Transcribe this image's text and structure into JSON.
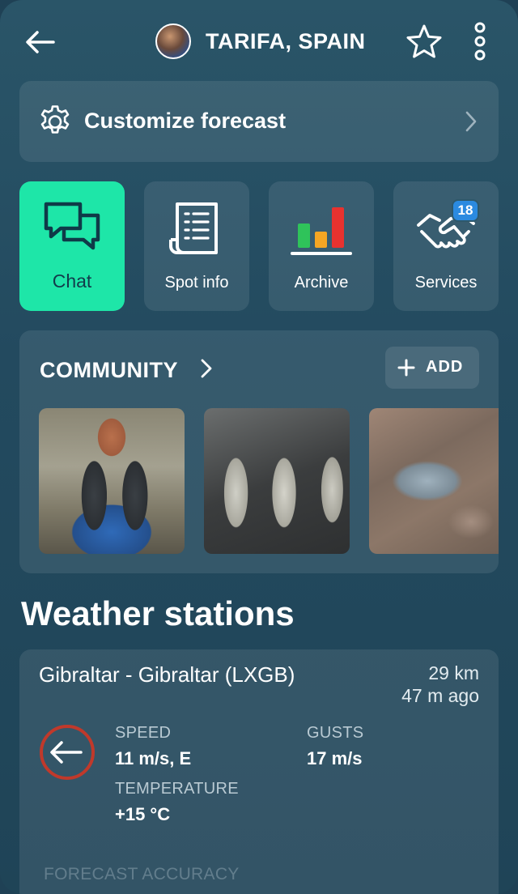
{
  "header": {
    "title": "TARIFA, SPAIN"
  },
  "customize": {
    "label": "Customize forecast"
  },
  "tiles": [
    {
      "label": "Chat",
      "icon": "chat-icon",
      "active": true
    },
    {
      "label": "Spot info",
      "icon": "document-icon"
    },
    {
      "label": "Archive",
      "icon": "bar-chart-icon"
    },
    {
      "label": "Services",
      "icon": "handshake-icon",
      "badge": "18"
    }
  ],
  "community": {
    "title": "COMMUNITY",
    "add_label": "ADD"
  },
  "weather": {
    "section_title": "Weather stations",
    "station": {
      "name": "Gibraltar - Gibraltar (LXGB)",
      "distance": "29 km",
      "updated": "47 m ago",
      "speed_label": "SPEED",
      "speed_value": "11 m/s, E",
      "gusts_label": "GUSTS",
      "gusts_value": "17 m/s",
      "temp_label": "TEMPERATURE",
      "temp_value": "+15 °C",
      "accuracy_label": "FORECAST ACCURACY"
    }
  },
  "colors": {
    "accent": "#1ee6a8",
    "badge": "#2b8ae0",
    "wind_ring": "#c0392b"
  }
}
